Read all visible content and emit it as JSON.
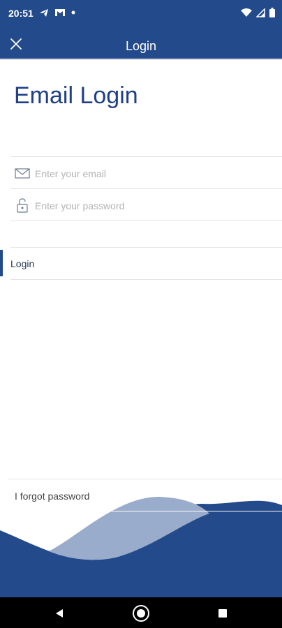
{
  "status_bar": {
    "time": "20:51",
    "left_icons": [
      "telegram-icon",
      "gmail-icon",
      "dot-icon"
    ],
    "right_icons": [
      "wifi-icon",
      "signal-icon",
      "battery-icon"
    ]
  },
  "app_bar": {
    "title": "Login",
    "close_icon": "close-icon",
    "background": "#234a8a"
  },
  "page": {
    "title": "Email Login"
  },
  "form": {
    "email": {
      "placeholder": "Enter your email",
      "value": "",
      "icon": "envelope-icon"
    },
    "password": {
      "placeholder": "Enter your password",
      "value": "",
      "icon": "lock-icon"
    },
    "login_label": "Login",
    "forgot_label": "I forgot password"
  },
  "colors": {
    "primary": "#234a8a",
    "wave_light": "#9aaccb"
  },
  "nav_bar": {
    "buttons": [
      "back-icon",
      "home-icon",
      "recents-icon"
    ]
  }
}
